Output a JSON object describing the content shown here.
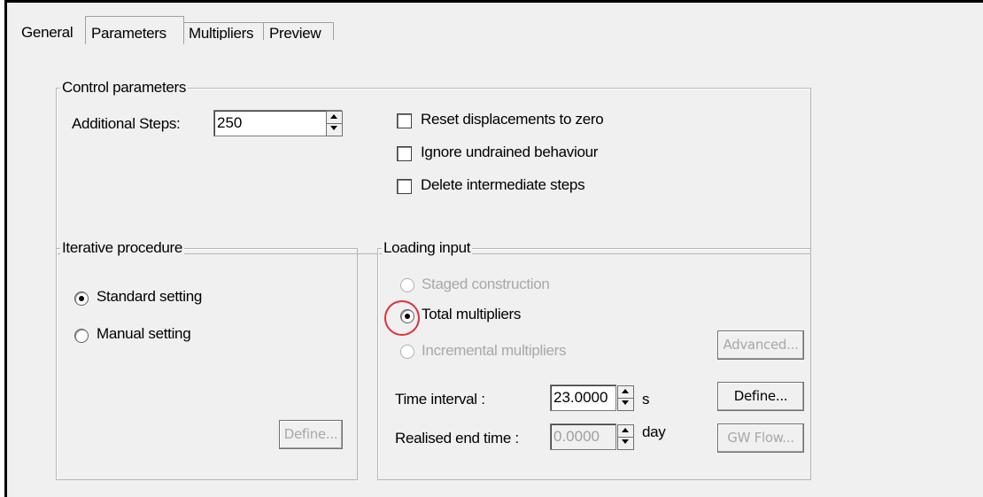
{
  "tabs": [
    {
      "label": "General"
    },
    {
      "label": "Parameters"
    },
    {
      "label": "Multipliers"
    },
    {
      "label": "Preview"
    }
  ],
  "control_parameters": {
    "title": "Control parameters",
    "additional_steps_label": "Additional Steps:",
    "additional_steps_value": "250",
    "checkboxes": [
      {
        "label": "Reset displacements to zero",
        "checked": false
      },
      {
        "label": "Ignore undrained behaviour",
        "checked": false
      },
      {
        "label": "Delete intermediate steps",
        "checked": false
      }
    ]
  },
  "iterative_procedure": {
    "title": "Iterative procedure",
    "options": [
      {
        "label": "Standard setting",
        "selected": true
      },
      {
        "label": "Manual setting",
        "selected": false
      }
    ],
    "define_label": "Define..."
  },
  "loading_input": {
    "title": "Loading input",
    "options": [
      {
        "label": "Staged construction",
        "selected": false,
        "enabled": false
      },
      {
        "label": "Total multipliers",
        "selected": true,
        "enabled": true
      },
      {
        "label": "Incremental multipliers",
        "selected": false,
        "enabled": false
      }
    ],
    "time_interval_label": "Time interval :",
    "time_interval_value": "23.0000",
    "time_interval_unit": "s",
    "realised_end_time_label": "Realised end time :",
    "realised_end_time_value": "0.0000",
    "realised_end_time_unit": "day",
    "advanced_label": "Advanced...",
    "define_label": "Define...",
    "gw_flow_label": "GW Flow..."
  },
  "colors": {
    "panel_bg": "#f0f0f0",
    "highlight_ring": "#e0303a",
    "disabled_text": "#a8a8a8"
  }
}
